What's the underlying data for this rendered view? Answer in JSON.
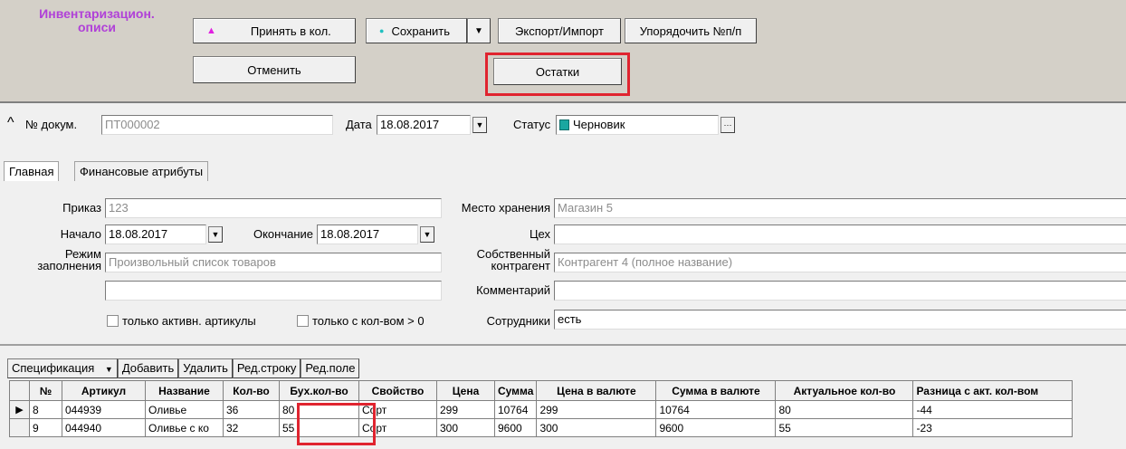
{
  "app": {
    "title": "Инвентаризацион. описи"
  },
  "toolbar": {
    "accept_label": "Принять в кол.",
    "save_label": "Сохранить",
    "export_label": "Экспорт/Импорт",
    "order_label": "Упорядочить №п/п",
    "cancel_label": "Отменить",
    "balances_label": "Остатки"
  },
  "header": {
    "docnum_label": "№ докум.",
    "docnum_value": "ПТ000002",
    "date_label": "Дата",
    "date_value": "18.08.2017",
    "status_label": "Статус",
    "status_value": "Черновик"
  },
  "tabs": [
    {
      "label": "Главная"
    },
    {
      "label": "Финансовые атрибуты"
    }
  ],
  "form": {
    "order_label": "Приказ",
    "order_value": "123",
    "start_label": "Начало",
    "start_value": "18.08.2017",
    "end_label": "Окончание",
    "end_value": "18.08.2017",
    "mode_label_1": "Режим",
    "mode_label_2": "заполнения",
    "mode_value": "Произвольный список товаров",
    "storage_label": "Место хранения",
    "storage_value": "Магазин 5",
    "shop_label": "Цех",
    "shop_value": "",
    "own_label_1": "Собственный",
    "own_label_2": "контрагент",
    "own_value": "Контрагент 4 (полное название)",
    "comment_label": "Комментарий",
    "comment_value": "",
    "extra_value": "",
    "active_only_label": "только активн. артикулы",
    "qty_only_label": "только с кол-вом > 0",
    "staff_label": "Сотрудники",
    "staff_value": "есть"
  },
  "spec_toolbar": {
    "spec_label": "Спецификация",
    "add_label": "Добавить",
    "delete_label": "Удалить",
    "edit_row_label": "Ред.строку",
    "edit_field_label": "Ред.поле"
  },
  "table": {
    "columns": [
      "№",
      "Артикул",
      "Название",
      "Кол-во",
      "Бух.кол-во",
      "Свойство",
      "Цена",
      "Сумма",
      "Цена в валюте",
      "Сумма в валюте",
      "Актуальное кол-во",
      "Разница с акт. кол-вом"
    ],
    "rows": [
      [
        "8",
        "044939",
        "Оливье",
        "36",
        "80",
        "Сорт",
        "299",
        "10764",
        "299",
        "10764",
        "80",
        "-44"
      ],
      [
        "9",
        "044940",
        "Оливье с ко",
        "32",
        "55",
        "Сорт",
        "300",
        "9600",
        "300",
        "9600",
        "55",
        "-23"
      ]
    ]
  },
  "colors": {
    "title": "#b040d8",
    "highlight": "#e0242f",
    "status_icon": "#1aa7a0"
  }
}
